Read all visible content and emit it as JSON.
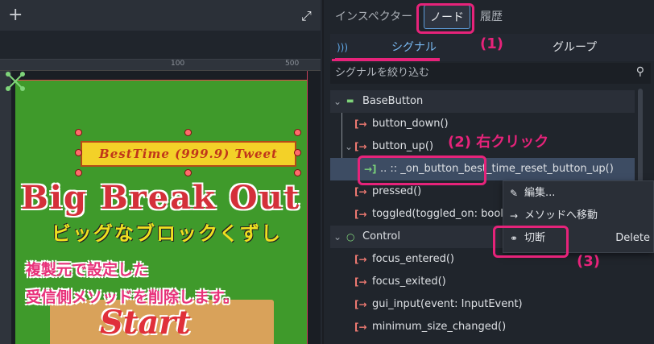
{
  "viewport": {
    "ruler_marks": [
      "100",
      "500"
    ],
    "tweet_button_text": "BestTime (999.9) Tweet",
    "game_title": "Big Break Out",
    "game_subtitle": "ビッグなブロックくずし",
    "note_line1": "複製元で設定した",
    "note_line2": "受信側メソッドを削除します。",
    "start_text": "Start"
  },
  "dock": {
    "tabs": [
      "インスペクター",
      "ノード",
      "履歴"
    ],
    "subtabs": [
      "シグナル",
      "グループ"
    ],
    "filter_placeholder": "シグナルを絞り込む"
  },
  "callouts": {
    "c1": "(1)",
    "c2": "(2) 右クリック",
    "c3": "(3)"
  },
  "tree": {
    "basebutton": "BaseButton",
    "button_down": "button_down()",
    "button_up": "button_up()",
    "connection": ".. :: _on_button_best_time_reset_button_up()",
    "pressed": "pressed()",
    "toggled": "toggled(toggled_on: bool)",
    "control": "Control",
    "focus_entered": "focus_entered()",
    "focus_exited": "focus_exited()",
    "gui_input": "gui_input(event: InputEvent)",
    "minimum_size_changed": "minimum_size_changed()"
  },
  "context_menu": {
    "edit": "編集...",
    "goto_method": "メソッドへ移動",
    "disconnect": "切断",
    "disconnect_shortcut": "Delete"
  },
  "colors": {
    "accent": "#e6237a",
    "selection": "#3d4c63",
    "game_bg": "#3f9a2b"
  }
}
